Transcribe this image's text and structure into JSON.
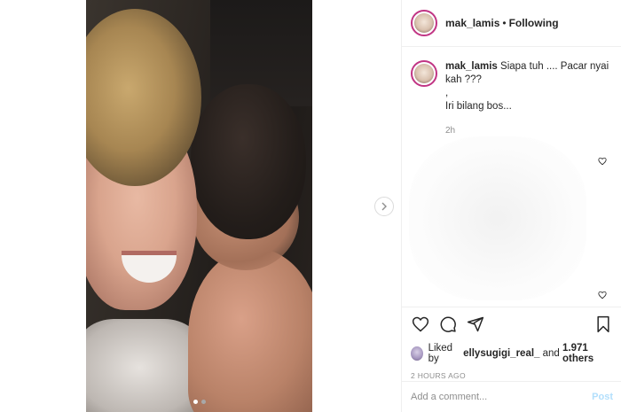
{
  "post": {
    "username": "mak_lamis",
    "separator": "•",
    "follow_status": "Following",
    "media_dots": 2,
    "active_dot": 0
  },
  "caption": {
    "username": "mak_lamis",
    "line1": "Siapa tuh .... Pacar nyai kah ???",
    "line2": ",",
    "line3": "Iri bilang bos...",
    "time": "2h"
  },
  "likes": {
    "prefix": "Liked by",
    "user": "ellysugigi_real_",
    "connector": "and",
    "count": "1.971 others"
  },
  "posted_ago": "2 HOURS AGO",
  "comment_box": {
    "placeholder": "Add a comment...",
    "post_label": "Post"
  },
  "icons": {
    "like": "heart-icon",
    "comment": "comment-icon",
    "share": "share-icon",
    "save": "bookmark-icon",
    "next": "chevron-right-icon"
  }
}
